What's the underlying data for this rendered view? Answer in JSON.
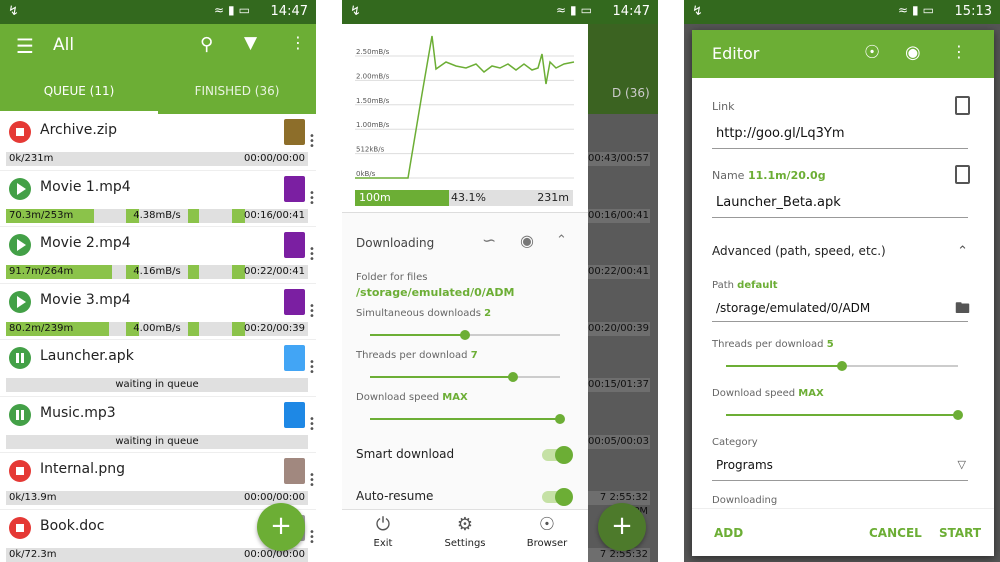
{
  "status": {
    "time_1": "14:47",
    "time_2": "14:47",
    "time_3": "15:13",
    "icons": "•••"
  },
  "colors": {
    "primary": "#6cae35",
    "dark": "#33691e",
    "stop": "#e53935",
    "play": "#43a047",
    "progress": "#8bc34a"
  },
  "list_screen": {
    "title": "All",
    "tabs": [
      {
        "label": "QUEUE (11)"
      },
      {
        "label": "FINISHED (36)"
      }
    ],
    "items": [
      {
        "name": "Archive.zip",
        "state": "stop",
        "icon": "zip-icon",
        "left": "0k/231m",
        "center": "",
        "right": "00:00/00:00",
        "progress": 0
      },
      {
        "name": "Movie 1.mp4",
        "state": "play",
        "icon": "film-icon",
        "left": "70.3m/253m",
        "center": "4.38mB/s",
        "right": "00:16/00:41",
        "progress": 0.28
      },
      {
        "name": "Movie 2.mp4",
        "state": "play",
        "icon": "film-icon",
        "left": "91.7m/264m",
        "center": "4.16mB/s",
        "right": "00:22/00:41",
        "progress": 0.35
      },
      {
        "name": "Movie 3.mp4",
        "state": "play",
        "icon": "film-icon",
        "left": "80.2m/239m",
        "center": "4.00mB/s",
        "right": "00:20/00:39",
        "progress": 0.34
      },
      {
        "name": "Launcher.apk",
        "state": "pause",
        "icon": "monitor-icon",
        "left": "",
        "center": "waiting in queue",
        "right": "",
        "progress": 0
      },
      {
        "name": "Music.mp3",
        "state": "pause",
        "icon": "music-note-icon",
        "left": "",
        "center": "waiting in queue",
        "right": "",
        "progress": 0
      },
      {
        "name": "Internal.png",
        "state": "stop",
        "icon": "image-icon",
        "left": "0k/13.9m",
        "center": "",
        "right": "00:00/00:00",
        "progress": 0
      },
      {
        "name": "Book.doc",
        "state": "stop",
        "icon": "doc-icon",
        "left": "0k/72.3m",
        "center": "",
        "right": "00:00/00:00",
        "progress": 0
      }
    ],
    "fab": "+"
  },
  "detail_screen": {
    "chart_ticks": [
      "2.50mB/s",
      "2.00mB/s",
      "1.50mB/s",
      "1.00mB/s",
      "512kB/s",
      "0kB/s"
    ],
    "progress": {
      "left": "100m",
      "center": "43.1%",
      "right": "231m",
      "fraction": 0.431
    },
    "section_title": "Downloading",
    "folder_label": "Folder for files",
    "folder_value": "/storage/emulated/0/ADM",
    "sim_label": "Simultaneous downloads",
    "sim_value": "2",
    "sim_level": 0.5,
    "threads_label": "Threads per download",
    "threads_value": "7",
    "threads_level": 0.75,
    "speed_label": "Download speed",
    "speed_value": "MAX",
    "speed_level": 1.0,
    "smart_label": "Smart download",
    "auto_label": "Auto-resume",
    "nav": [
      {
        "label": "Exit",
        "icon": "power-icon"
      },
      {
        "label": "Settings",
        "icon": "gear-icon"
      },
      {
        "label": "Browser",
        "icon": "globe-icon"
      }
    ],
    "bg_right_values": [
      "00:43/00:57",
      "00:16/00:41",
      "00:22/00:41",
      "00:20/00:39",
      "00:15/01:37",
      "00:05/00:03",
      "7 2:55:32 PM",
      "7 2:55:32 PM"
    ],
    "bg_tab": "D (36)"
  },
  "editor": {
    "title": "Editor",
    "link_label": "Link",
    "link_value": "http://goo.gl/Lq3Ym",
    "name_label": "Name",
    "name_size": "11.1m/20.0g",
    "name_value": "Launcher_Beta.apk",
    "advanced_label": "Advanced (path, speed, etc.)",
    "path_label": "Path",
    "path_tag": "default",
    "path_value": "/storage/emulated/0/ADM",
    "threads_label": "Threads per download",
    "threads_value": "5",
    "threads_level": 0.5,
    "speed_label": "Download speed",
    "speed_value": "MAX",
    "speed_level": 1.0,
    "category_label": "Category",
    "category_value": "Programs",
    "downloading_label": "Downloading",
    "buttons": {
      "add": "ADD",
      "cancel": "CANCEL",
      "start": "START"
    }
  }
}
